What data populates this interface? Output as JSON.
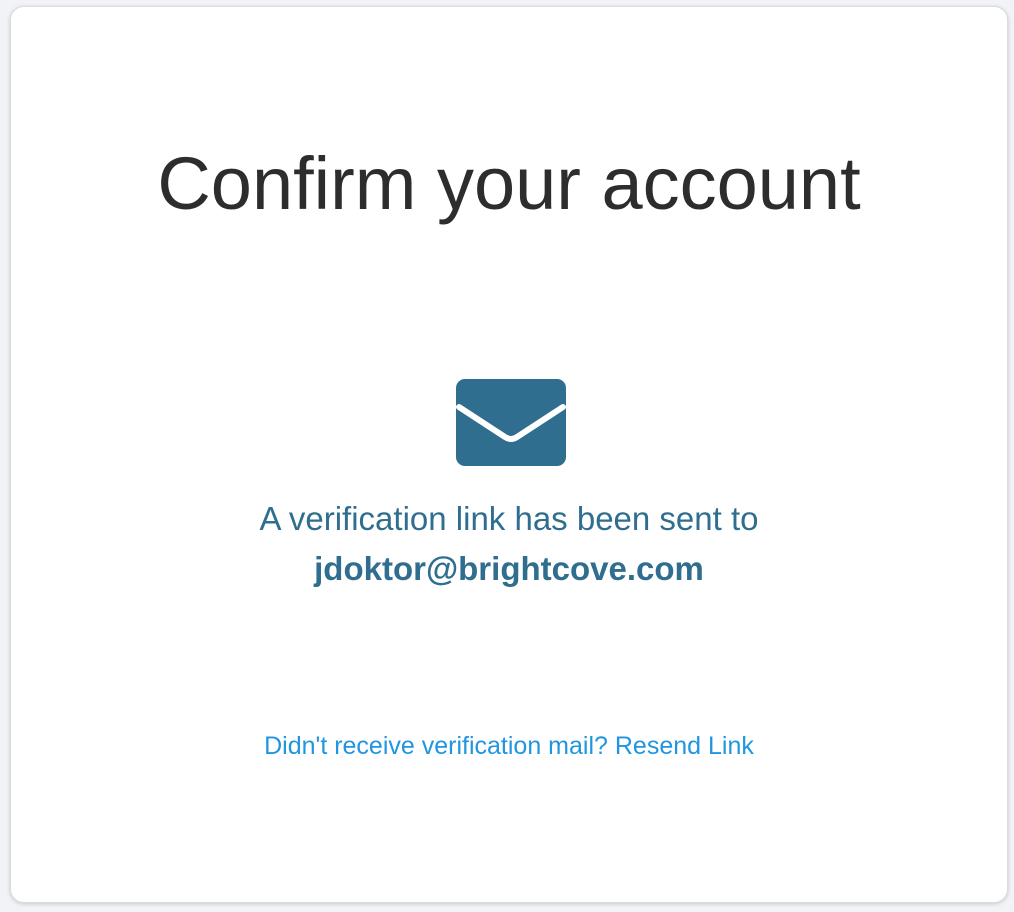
{
  "card": {
    "title": "Confirm your account",
    "icon": "envelope-icon",
    "message": "A verification link has been sent to",
    "email": "jdoktor@brightcove.com",
    "resend_text": "Didn't receive verification mail? Resend Link"
  },
  "colors": {
    "title": "#2d2d2d",
    "accent": "#2f6e8e",
    "link": "#2196e0",
    "background": "#ffffff"
  }
}
